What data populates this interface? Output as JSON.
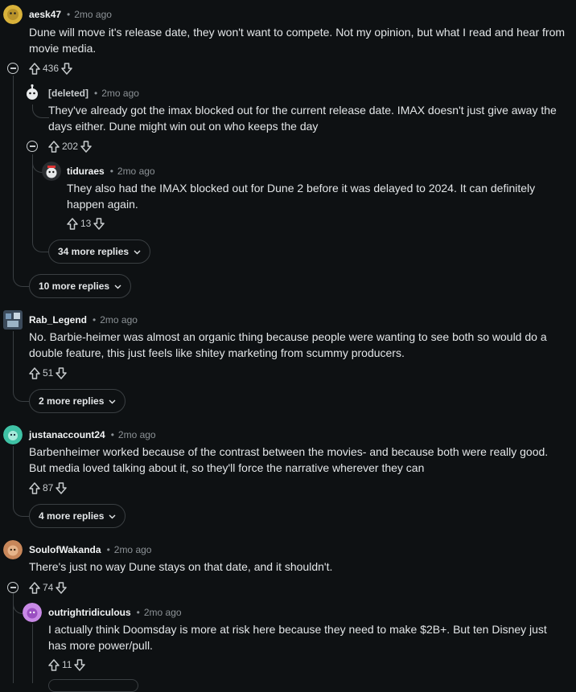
{
  "comments": [
    {
      "user": "aesk47",
      "time": "2mo ago",
      "text": "Dune will move it's release date, they won't want to compete. Not my opinion, but what I read and hear from movie media.",
      "votes": "436"
    },
    {
      "user": "[deleted]",
      "time": "2mo ago",
      "text": "They've already got the imax blocked out for the current release date. IMAX doesn't just give away the days either. Dune might win out on who keeps the day",
      "votes": "202"
    },
    {
      "user": "tiduraes",
      "time": "2mo ago",
      "text": "They also had the IMAX blocked out for Dune 2 before it was delayed to 2024. It can definitely happen again.",
      "votes": "13"
    },
    {
      "user": "Rab_Legend",
      "time": "2mo ago",
      "text": "No. Barbie-heimer was almost an organic thing because people were wanting to see both so would do a double feature, this just feels like shitey marketing from scummy producers.",
      "votes": "51"
    },
    {
      "user": "justanaccount24",
      "time": "2mo ago",
      "text": "Barbenheimer worked because of the contrast between the movies- and because both were really good. But media loved talking about it, so they'll force the narrative wherever they can",
      "votes": "87"
    },
    {
      "user": "SoulofWakanda",
      "time": "2mo ago",
      "text": "There's just no way Dune stays on that date, and it shouldn't.",
      "votes": "74"
    },
    {
      "user": "outrightridiculous",
      "time": "2mo ago",
      "text": "I actually think Doomsday is more at risk here because they need to make $2B+. But ten Disney just has more power/pull.",
      "votes": "11"
    }
  ],
  "more_replies": [
    "34 more replies",
    "10 more replies",
    "2 more replies",
    "4 more replies"
  ],
  "separator": "•"
}
